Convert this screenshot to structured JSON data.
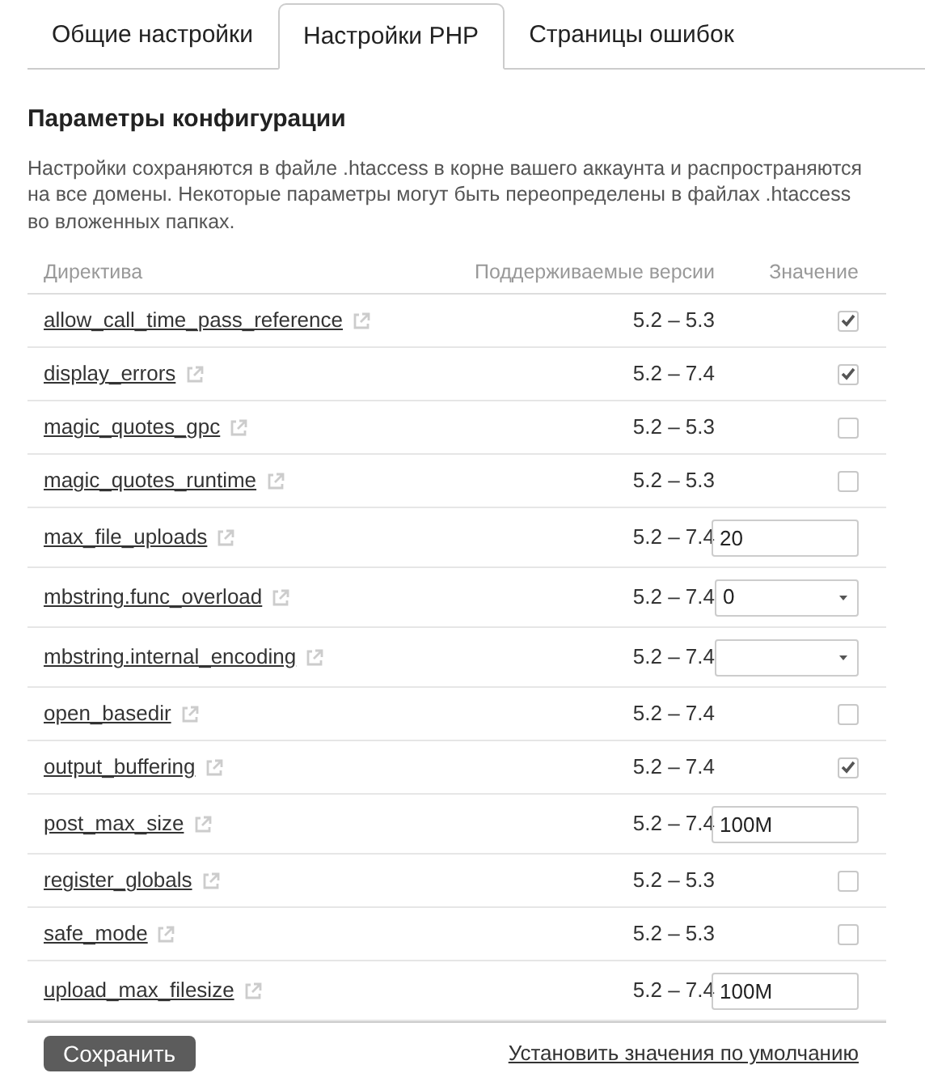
{
  "tabs": [
    {
      "label": "Общие настройки",
      "selected": false
    },
    {
      "label": "Настройки PHP",
      "selected": true
    },
    {
      "label": "Страницы ошибок",
      "selected": false
    }
  ],
  "heading": "Параметры конфигурации",
  "description": "Настройки сохраняются в файле .htaccess в корне вашего аккаунта и распространяются на все домены. Некоторые параметры могут быть переопределены в файлах .htaccess во вложенных папках.",
  "table": {
    "columns": [
      "Директива",
      "Поддерживаемые версии",
      "Значение"
    ],
    "rows": [
      {
        "directive": "allow_call_time_pass_reference",
        "versions": "5.2 – 5.3",
        "kind": "checkbox",
        "checked": true
      },
      {
        "directive": "display_errors",
        "versions": "5.2 – 7.4",
        "kind": "checkbox",
        "checked": true
      },
      {
        "directive": "magic_quotes_gpc",
        "versions": "5.2 – 5.3",
        "kind": "checkbox",
        "checked": false
      },
      {
        "directive": "magic_quotes_runtime",
        "versions": "5.2 – 5.3",
        "kind": "checkbox",
        "checked": false
      },
      {
        "directive": "max_file_uploads",
        "versions": "5.2 – 7.4",
        "kind": "text",
        "value": "20"
      },
      {
        "directive": "mbstring.func_overload",
        "versions": "5.2 – 7.4",
        "kind": "select",
        "value": "0"
      },
      {
        "directive": "mbstring.internal_encoding",
        "versions": "5.2 – 7.4",
        "kind": "select"
      },
      {
        "directive": "open_basedir",
        "versions": "5.2 – 7.4",
        "kind": "checkbox",
        "checked": false
      },
      {
        "directive": "output_buffering",
        "versions": "5.2 – 7.4",
        "kind": "checkbox",
        "checked": true
      },
      {
        "directive": "post_max_size",
        "versions": "5.2 – 7.4",
        "kind": "text",
        "value": "100M"
      },
      {
        "directive": "register_globals",
        "versions": "5.2 – 5.3",
        "kind": "checkbox",
        "checked": false
      },
      {
        "directive": "safe_mode",
        "versions": "5.2 – 5.3",
        "kind": "checkbox",
        "checked": false
      },
      {
        "directive": "upload_max_filesize",
        "versions": "5.2 – 7.4",
        "kind": "text",
        "value": "100M"
      }
    ]
  },
  "save_button": "Сохранить",
  "reset_link": "Установить значения по умолчанию"
}
